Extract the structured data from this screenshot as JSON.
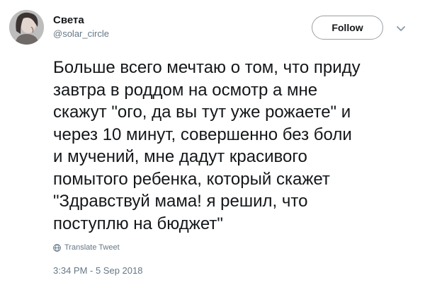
{
  "user": {
    "display_name": "Света",
    "handle": "@solar_circle"
  },
  "follow_label": "Follow",
  "tweet": {
    "text": "Больше всего мечтаю о том, что приду\nзавтра в роддом на осмотр а мне\nскажут \"ого, да вы тут уже рожаете\" и\nчерез 10 минут, совершенно без боли\nи мучений, мне дадут красивого\nпомытого ребенка, который скажет\n\"Здравствуй мама! я решил, что\nпоступлю на бюджет\"",
    "translate_label": "Translate Tweet",
    "timestamp": "3:34 PM - 5 Sep 2018"
  },
  "icons": {
    "more": "chevron-down-icon",
    "translate": "globe-icon"
  },
  "colors": {
    "text": "#14171a",
    "secondary": "#657786",
    "button_border": "#9aa0a6"
  }
}
